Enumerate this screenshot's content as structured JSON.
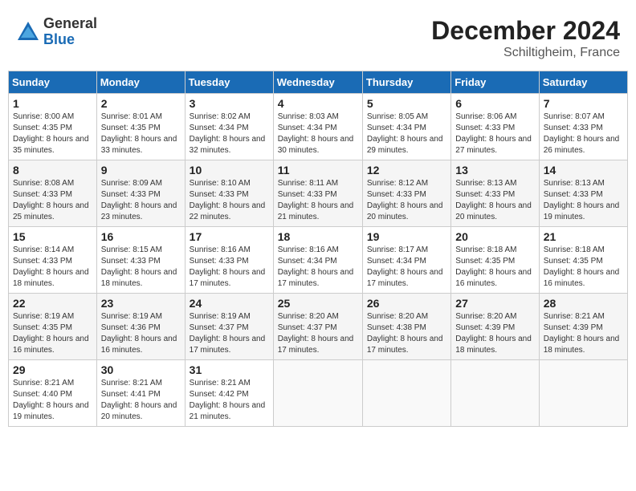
{
  "logo": {
    "general": "General",
    "blue": "Blue"
  },
  "header": {
    "month": "December 2024",
    "location": "Schiltigheim, France"
  },
  "weekdays": [
    "Sunday",
    "Monday",
    "Tuesday",
    "Wednesday",
    "Thursday",
    "Friday",
    "Saturday"
  ],
  "weeks": [
    [
      {
        "day": "1",
        "sunrise": "8:00 AM",
        "sunset": "4:35 PM",
        "daylight": "8 hours and 35 minutes."
      },
      {
        "day": "2",
        "sunrise": "8:01 AM",
        "sunset": "4:35 PM",
        "daylight": "8 hours and 33 minutes."
      },
      {
        "day": "3",
        "sunrise": "8:02 AM",
        "sunset": "4:34 PM",
        "daylight": "8 hours and 32 minutes."
      },
      {
        "day": "4",
        "sunrise": "8:03 AM",
        "sunset": "4:34 PM",
        "daylight": "8 hours and 30 minutes."
      },
      {
        "day": "5",
        "sunrise": "8:05 AM",
        "sunset": "4:34 PM",
        "daylight": "8 hours and 29 minutes."
      },
      {
        "day": "6",
        "sunrise": "8:06 AM",
        "sunset": "4:33 PM",
        "daylight": "8 hours and 27 minutes."
      },
      {
        "day": "7",
        "sunrise": "8:07 AM",
        "sunset": "4:33 PM",
        "daylight": "8 hours and 26 minutes."
      }
    ],
    [
      {
        "day": "8",
        "sunrise": "8:08 AM",
        "sunset": "4:33 PM",
        "daylight": "8 hours and 25 minutes."
      },
      {
        "day": "9",
        "sunrise": "8:09 AM",
        "sunset": "4:33 PM",
        "daylight": "8 hours and 23 minutes."
      },
      {
        "day": "10",
        "sunrise": "8:10 AM",
        "sunset": "4:33 PM",
        "daylight": "8 hours and 22 minutes."
      },
      {
        "day": "11",
        "sunrise": "8:11 AM",
        "sunset": "4:33 PM",
        "daylight": "8 hours and 21 minutes."
      },
      {
        "day": "12",
        "sunrise": "8:12 AM",
        "sunset": "4:33 PM",
        "daylight": "8 hours and 20 minutes."
      },
      {
        "day": "13",
        "sunrise": "8:13 AM",
        "sunset": "4:33 PM",
        "daylight": "8 hours and 20 minutes."
      },
      {
        "day": "14",
        "sunrise": "8:13 AM",
        "sunset": "4:33 PM",
        "daylight": "8 hours and 19 minutes."
      }
    ],
    [
      {
        "day": "15",
        "sunrise": "8:14 AM",
        "sunset": "4:33 PM",
        "daylight": "8 hours and 18 minutes."
      },
      {
        "day": "16",
        "sunrise": "8:15 AM",
        "sunset": "4:33 PM",
        "daylight": "8 hours and 18 minutes."
      },
      {
        "day": "17",
        "sunrise": "8:16 AM",
        "sunset": "4:33 PM",
        "daylight": "8 hours and 17 minutes."
      },
      {
        "day": "18",
        "sunrise": "8:16 AM",
        "sunset": "4:34 PM",
        "daylight": "8 hours and 17 minutes."
      },
      {
        "day": "19",
        "sunrise": "8:17 AM",
        "sunset": "4:34 PM",
        "daylight": "8 hours and 17 minutes."
      },
      {
        "day": "20",
        "sunrise": "8:18 AM",
        "sunset": "4:35 PM",
        "daylight": "8 hours and 16 minutes."
      },
      {
        "day": "21",
        "sunrise": "8:18 AM",
        "sunset": "4:35 PM",
        "daylight": "8 hours and 16 minutes."
      }
    ],
    [
      {
        "day": "22",
        "sunrise": "8:19 AM",
        "sunset": "4:35 PM",
        "daylight": "8 hours and 16 minutes."
      },
      {
        "day": "23",
        "sunrise": "8:19 AM",
        "sunset": "4:36 PM",
        "daylight": "8 hours and 16 minutes."
      },
      {
        "day": "24",
        "sunrise": "8:19 AM",
        "sunset": "4:37 PM",
        "daylight": "8 hours and 17 minutes."
      },
      {
        "day": "25",
        "sunrise": "8:20 AM",
        "sunset": "4:37 PM",
        "daylight": "8 hours and 17 minutes."
      },
      {
        "day": "26",
        "sunrise": "8:20 AM",
        "sunset": "4:38 PM",
        "daylight": "8 hours and 17 minutes."
      },
      {
        "day": "27",
        "sunrise": "8:20 AM",
        "sunset": "4:39 PM",
        "daylight": "8 hours and 18 minutes."
      },
      {
        "day": "28",
        "sunrise": "8:21 AM",
        "sunset": "4:39 PM",
        "daylight": "8 hours and 18 minutes."
      }
    ],
    [
      {
        "day": "29",
        "sunrise": "8:21 AM",
        "sunset": "4:40 PM",
        "daylight": "8 hours and 19 minutes."
      },
      {
        "day": "30",
        "sunrise": "8:21 AM",
        "sunset": "4:41 PM",
        "daylight": "8 hours and 20 minutes."
      },
      {
        "day": "31",
        "sunrise": "8:21 AM",
        "sunset": "4:42 PM",
        "daylight": "8 hours and 21 minutes."
      },
      null,
      null,
      null,
      null
    ]
  ]
}
